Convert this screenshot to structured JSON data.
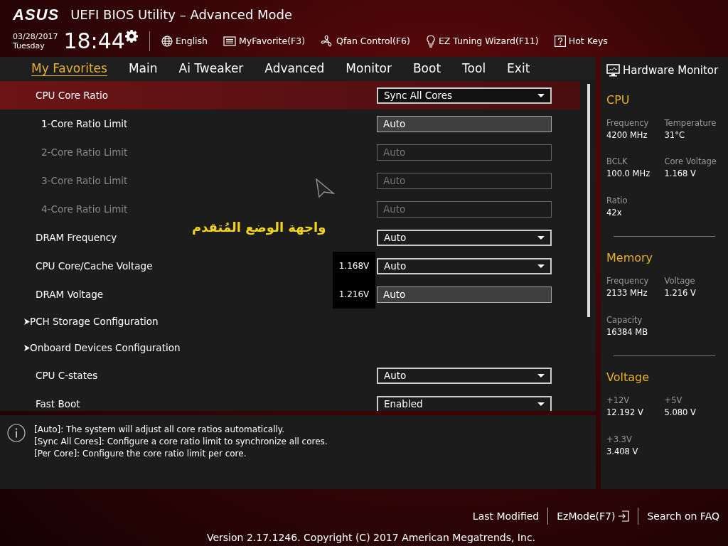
{
  "header": {
    "logo": "ASUS",
    "title": "UEFI BIOS Utility – Advanced Mode",
    "date": "03/28/2017",
    "day": "Tuesday",
    "time": "18:44",
    "toolbar": [
      {
        "kind": "globe",
        "label": "English"
      },
      {
        "kind": "list",
        "label": "MyFavorite(F3)"
      },
      {
        "kind": "fan",
        "label": "Qfan Control(F6)"
      },
      {
        "kind": "bulb",
        "label": "EZ Tuning Wizard(F11)"
      },
      {
        "kind": "help",
        "label": "Hot Keys"
      }
    ]
  },
  "tabs": [
    {
      "label": "My Favorites",
      "selected": true
    },
    {
      "label": "Main",
      "selected": false
    },
    {
      "label": "Ai Tweaker",
      "selected": false
    },
    {
      "label": "Advanced",
      "selected": false
    },
    {
      "label": "Monitor",
      "selected": false
    },
    {
      "label": "Boot",
      "selected": false
    },
    {
      "label": "Tool",
      "selected": false
    },
    {
      "label": "Exit",
      "selected": false
    }
  ],
  "settings": [
    {
      "kind": "dropdown",
      "label": "CPU Core Ratio",
      "value": "Sync All Cores",
      "selected": true,
      "children": [
        {
          "kind": "field",
          "label": "1-Core Ratio Limit",
          "value": "Auto",
          "disabled": false
        },
        {
          "kind": "field",
          "label": "2-Core Ratio Limit",
          "value": "Auto",
          "disabled": true
        },
        {
          "kind": "field",
          "label": "3-Core Ratio Limit",
          "value": "Auto",
          "disabled": true
        },
        {
          "kind": "field",
          "label": "4-Core Ratio Limit",
          "value": "Auto",
          "disabled": true
        }
      ]
    },
    {
      "kind": "dropdown",
      "label": "DRAM Frequency",
      "value": "Auto",
      "selected": false
    },
    {
      "kind": "dropdown",
      "label": "CPU Core/Cache Voltage",
      "value": "Auto",
      "reading": "1.168V",
      "selected": false
    },
    {
      "kind": "field",
      "label": "DRAM Voltage",
      "value": "Auto",
      "reading": "1.216V",
      "selected": false,
      "disabled": false
    },
    {
      "kind": "submenu",
      "label": "PCH Storage Configuration",
      "selected": false
    },
    {
      "kind": "submenu",
      "label": "Onboard Devices Configuration",
      "selected": false
    },
    {
      "kind": "dropdown",
      "label": "CPU C-states",
      "value": "Auto",
      "selected": false
    },
    {
      "kind": "dropdown",
      "label": "Fast Boot",
      "value": "Enabled",
      "selected": false
    }
  ],
  "annotation": "واجهة الوضع المُتقدم",
  "help": [
    "[Auto]: The system will adjust all core ratios automatically.",
    "[Sync All Cores]: Configure a core ratio limit to synchronize all cores.",
    "[Per Core]: Configure the core ratio limit per core."
  ],
  "hardware_monitor": {
    "title": "Hardware Monitor",
    "sections": [
      {
        "title": "CPU",
        "items": [
          {
            "label": "Frequency",
            "value": "4200 MHz"
          },
          {
            "label": "Temperature",
            "value": "31°C"
          },
          {
            "label": "BCLK",
            "value": "100.0 MHz"
          },
          {
            "label": "Core Voltage",
            "value": "1.168 V"
          },
          {
            "label": "Ratio",
            "value": "42x"
          }
        ]
      },
      {
        "title": "Memory",
        "items": [
          {
            "label": "Frequency",
            "value": "2133 MHz"
          },
          {
            "label": "Voltage",
            "value": "1.216 V"
          },
          {
            "label": "Capacity",
            "value": "16384 MB"
          }
        ]
      },
      {
        "title": "Voltage",
        "items": [
          {
            "label": "+12V",
            "value": "12.192 V"
          },
          {
            "label": "+5V",
            "value": "5.080 V"
          },
          {
            "label": "+3.3V",
            "value": "3.408 V"
          }
        ]
      }
    ]
  },
  "footer": {
    "links": [
      {
        "label": "Last Modified",
        "kind": "plain"
      },
      {
        "label": "EzMode(F7)",
        "kind": "exit"
      },
      {
        "label": "Search on FAQ",
        "kind": "plain"
      }
    ],
    "version": "Version 2.17.1246. Copyright (C) 2017 American Megatrends, Inc."
  }
}
